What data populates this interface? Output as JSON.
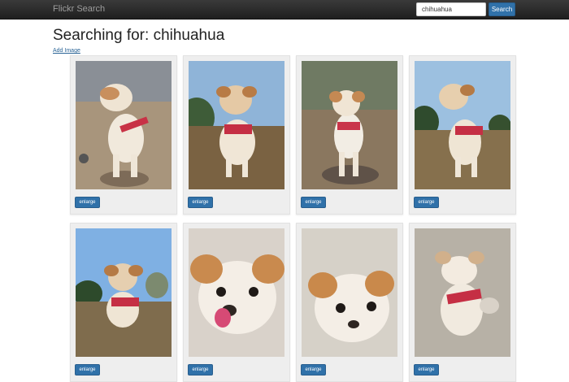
{
  "navbar": {
    "brand": "Flickr Search",
    "search_value": "chihuahua",
    "search_button": "Search"
  },
  "main": {
    "title": "Searching for: chihuahua",
    "add_image_link": "Add Image"
  },
  "results": [
    {
      "enlarge_label": "enlarge",
      "scene": "dog-standing-side"
    },
    {
      "enlarge_label": "enlarge",
      "scene": "dog-standing-trees"
    },
    {
      "enlarge_label": "enlarge",
      "scene": "dog-standing-front"
    },
    {
      "enlarge_label": "enlarge",
      "scene": "dog-standing-trees-2"
    },
    {
      "enlarge_label": "enlarge",
      "scene": "dog-sky-trees"
    },
    {
      "enlarge_label": "enlarge",
      "scene": "dog-closeup-tongue"
    },
    {
      "enlarge_label": "enlarge",
      "scene": "dog-closeup-face"
    },
    {
      "enlarge_label": "enlarge",
      "scene": "dog-fluffy-front"
    }
  ]
}
